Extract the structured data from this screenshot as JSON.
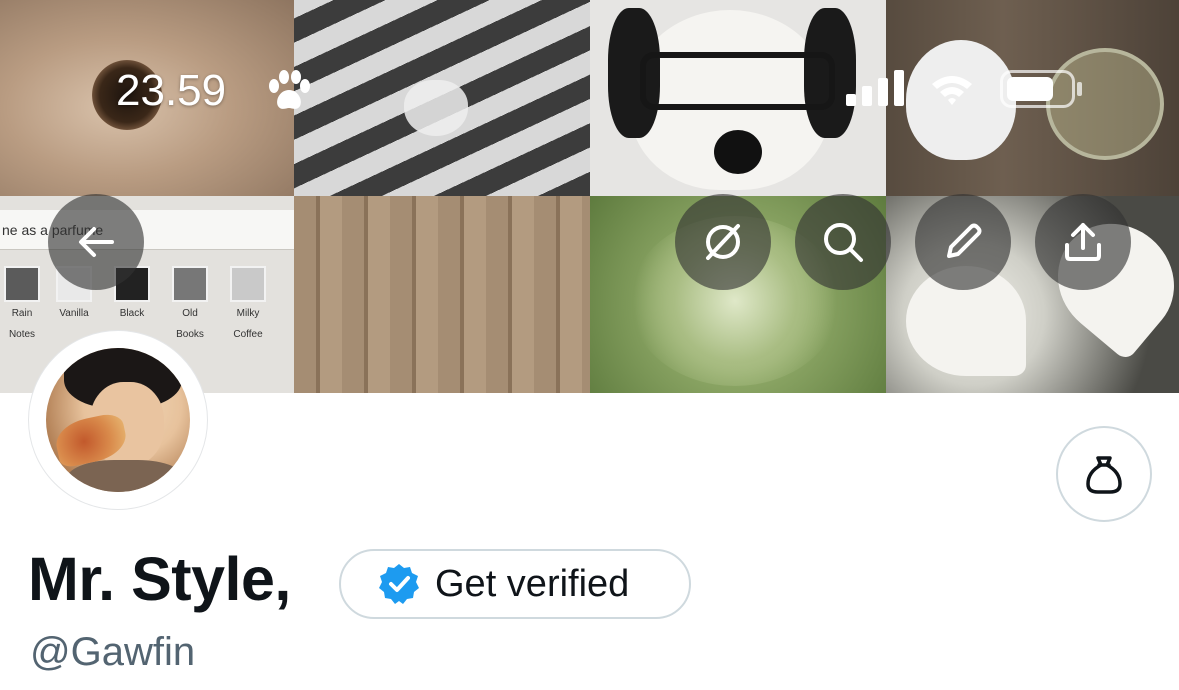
{
  "status_bar": {
    "time": "23.59",
    "time_icon": "paw-icon",
    "signal_icon": "cellular-signal-icon",
    "wifi_icon": "wifi-icon",
    "battery_icon": "battery-icon"
  },
  "banner": {
    "back_icon": "arrow-left-icon",
    "actions": [
      {
        "icon": "circle-slash-icon"
      },
      {
        "icon": "search-icon"
      },
      {
        "icon": "pencil-icon"
      },
      {
        "icon": "share-icon"
      }
    ],
    "shelf_text": "ne as a parfume",
    "products": [
      {
        "line1": "Rain",
        "line2": "Notes"
      },
      {
        "line1": "Vanilla",
        "line2": ""
      },
      {
        "line1": "Black",
        "line2": ""
      },
      {
        "line1": "Old",
        "line2": "Books"
      },
      {
        "line1": "Milky",
        "line2": "Coffee"
      }
    ]
  },
  "profile": {
    "display_name": "Mr. Style,",
    "handle": "@Gawfin",
    "verify_label": "Get verified",
    "tips_icon": "money-bag-icon"
  },
  "colors": {
    "text_primary": "#0f1419",
    "text_secondary": "#536471",
    "border": "#cfd9de",
    "verified_blue": "#1d9bf0"
  }
}
